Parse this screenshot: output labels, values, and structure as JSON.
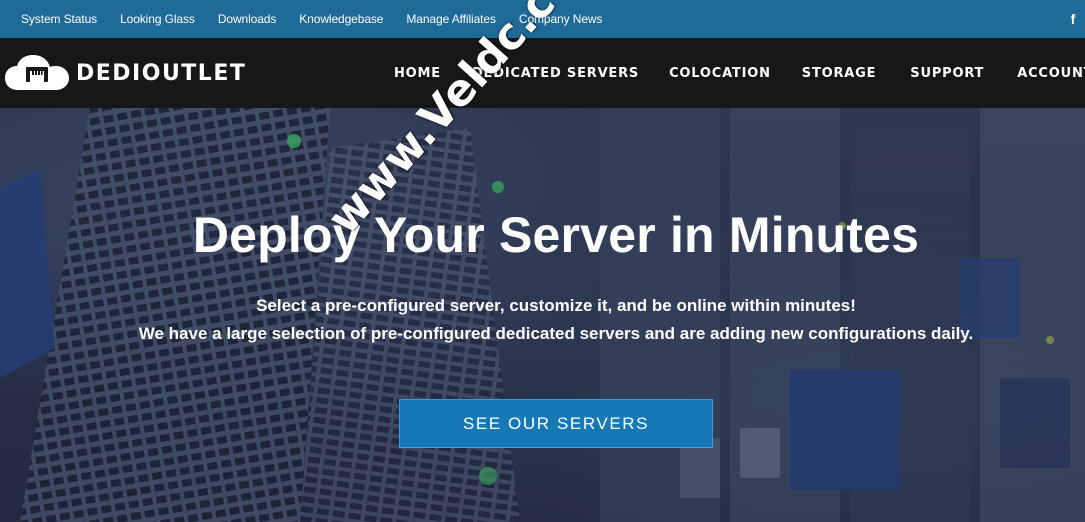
{
  "topbar": {
    "links": [
      {
        "label": "System Status"
      },
      {
        "label": "Looking Glass"
      },
      {
        "label": "Downloads"
      },
      {
        "label": "Knowledgebase"
      },
      {
        "label": "Manage Affiliates"
      },
      {
        "label": "Company News"
      }
    ],
    "social_icon": "facebook-icon",
    "social_glyph": "f"
  },
  "brand": {
    "name": "DEDIOUTLET",
    "logo_icon": "cloud-ethernet-icon"
  },
  "nav": {
    "items": [
      {
        "label": "HOME"
      },
      {
        "label": "DEDICATED SERVERS"
      },
      {
        "label": "COLOCATION"
      },
      {
        "label": "STORAGE"
      },
      {
        "label": "SUPPORT"
      },
      {
        "label": "ACCOUNT"
      }
    ]
  },
  "hero": {
    "title": "Deploy Your Server in Minutes",
    "subtitle_line1": "Select a pre-configured server, customize it, and be online within minutes!",
    "subtitle_line2": "We have a large selection of pre-configured dedicated servers and are adding new configurations daily.",
    "cta_label": "SEE OUR SERVERS"
  },
  "watermark": {
    "text": "www.Veldc.com"
  },
  "colors": {
    "topbar_bg": "#1e6a99",
    "nav_bg": "#151719",
    "cta_bg": "#1679b5",
    "text": "#ffffff"
  }
}
